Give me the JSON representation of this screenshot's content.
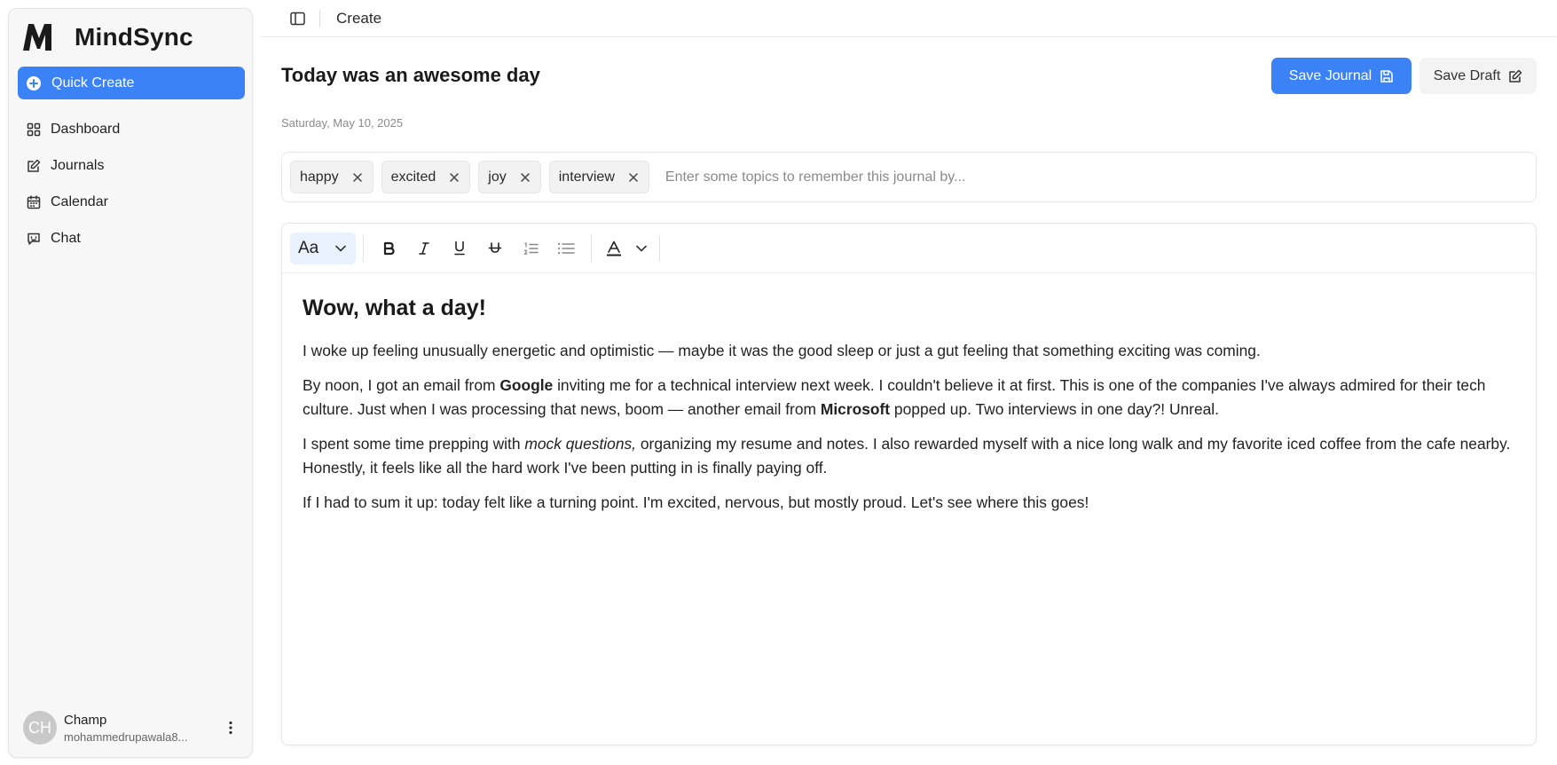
{
  "app": {
    "name": "MindSync"
  },
  "sidebar": {
    "quick_create": "Quick Create",
    "items": [
      {
        "label": "Dashboard",
        "icon": "dashboard-icon"
      },
      {
        "label": "Journals",
        "icon": "journal-edit-icon"
      },
      {
        "label": "Calendar",
        "icon": "calendar-icon"
      },
      {
        "label": "Chat",
        "icon": "chat-icon"
      }
    ],
    "user": {
      "initials": "CH",
      "name": "Champ",
      "email": "mohammedrupawala8..."
    }
  },
  "topbar": {
    "title": "Create"
  },
  "journal": {
    "title": "Today was an awesome day",
    "date": "Saturday, May 10, 2025",
    "save_journal": "Save Journal",
    "save_draft": "Save Draft"
  },
  "tags": {
    "items": [
      "happy",
      "excited",
      "joy",
      "interview"
    ],
    "placeholder": "Enter some topics to remember this journal by..."
  },
  "toolbar": {
    "font_label": "Aa"
  },
  "content": {
    "heading": "Wow, what a day!",
    "p1": "I woke up feeling unusually energetic and optimistic — maybe it was the good sleep or just a gut feeling that something exciting was coming.",
    "p2": {
      "a": "By noon, I got an email from ",
      "b": "Google",
      "c": " inviting me for a technical interview next week. I couldn't believe it at first. This is one of the companies I've always admired for their tech culture. Just when I was processing that news, boom — another email from ",
      "d": "Microsoft",
      "e": " popped up. Two interviews in one day?! Unreal."
    },
    "p3": {
      "a": "I spent some time prepping with ",
      "b": "mock questions,",
      "c": " organizing my resume and notes. I also rewarded myself with a nice long walk and my favorite iced coffee from the cafe nearby. Honestly, it feels like all the hard work I've been putting in is finally paying off."
    },
    "p4": "If I had to sum it up: today felt like a turning point. I'm excited, nervous, but mostly proud. Let's see where this goes!"
  },
  "colors": {
    "accent": "#3b82f6",
    "sidebar_bg": "#f7f7f7",
    "chip_bg": "#f2f2f2",
    "font_btn_bg": "#e8f1fd"
  }
}
